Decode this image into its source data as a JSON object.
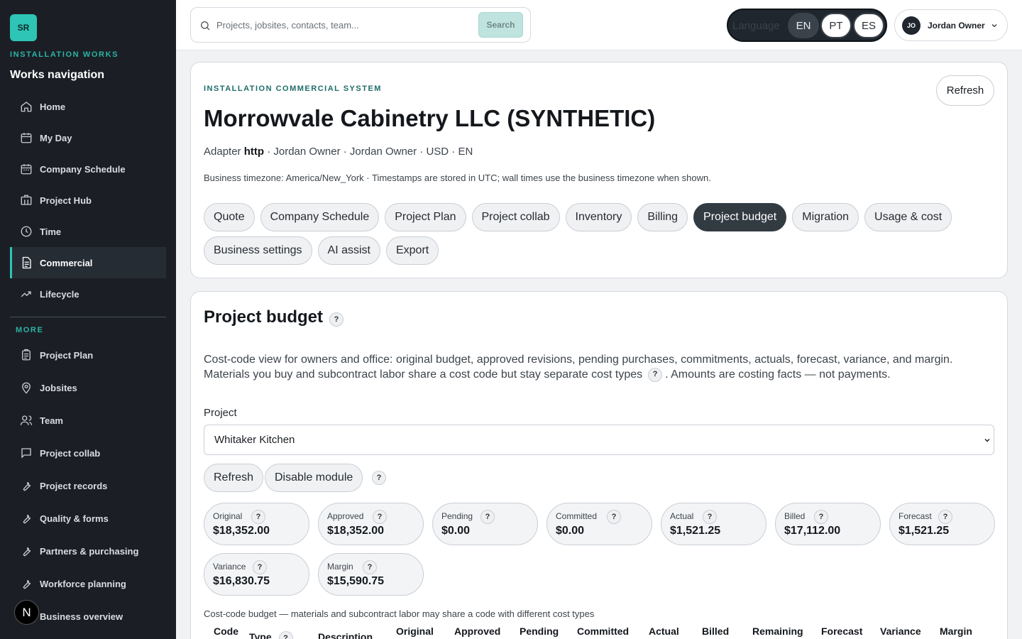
{
  "sidebar": {
    "logo_text": "SR",
    "brand_label": "INSTALLATION WORKS",
    "nav_title": "Works navigation",
    "items": [
      {
        "label": "Home",
        "icon": "home-icon"
      },
      {
        "label": "My Day",
        "icon": "calendar-icon"
      },
      {
        "label": "Company Schedule",
        "icon": "calendar-icon"
      },
      {
        "label": "Project Hub",
        "icon": "building-icon"
      },
      {
        "label": "Time",
        "icon": "clock-icon"
      },
      {
        "label": "Commercial",
        "icon": "document-icon",
        "active": true
      },
      {
        "label": "Lifecycle",
        "icon": "trend-icon"
      }
    ],
    "more_label": "MORE",
    "more_items": [
      {
        "label": "Project Plan",
        "icon": "clipboard-icon"
      },
      {
        "label": "Jobsites",
        "icon": "map-pin-icon"
      },
      {
        "label": "Team",
        "icon": "users-icon"
      },
      {
        "label": "Project collab",
        "icon": "chat-icon"
      },
      {
        "label": "Project records",
        "icon": "wrench-icon"
      },
      {
        "label": "Quality & forms",
        "icon": "wrench-icon"
      },
      {
        "label": "Partners & purchasing",
        "icon": "wrench-icon"
      },
      {
        "label": "Workforce planning",
        "icon": "wrench-icon"
      },
      {
        "label": "Business overview",
        "icon": "wrench-icon"
      }
    ],
    "dev_badge": "N"
  },
  "topbar": {
    "search_placeholder": "Projects, jobsites, contacts, team...",
    "search_button": "Search",
    "language_label": "Language",
    "languages": [
      "EN",
      "PT",
      "ES"
    ],
    "active_language": "EN",
    "user_initials": "JO",
    "user_name": "Jordan Owner"
  },
  "header": {
    "eyebrow": "INSTALLATION COMMERCIAL SYSTEM",
    "company": "Morrowvale Cabinetry LLC (SYNTHETIC)",
    "meta_prefix": "Adapter",
    "adapter": "http",
    "meta_rest": "· Jordan Owner · Jordan Owner · USD · EN",
    "timezone": "Business timezone: America/New_York · Timestamps are stored in UTC; wall times use the business timezone when shown.",
    "refresh": "Refresh",
    "tabs_row1": [
      "Quote",
      "Company Schedule",
      "Project Plan",
      "Project collab",
      "Inventory",
      "Billing",
      "Project budget",
      "Migration",
      "Usage & cost"
    ],
    "tabs_row2": [
      "Business settings",
      "AI assist",
      "Export"
    ],
    "active_tab": "Project budget"
  },
  "budget": {
    "title": "Project budget",
    "help": "?",
    "desc_part1": "Cost-code view for owners and office: original budget, approved revisions, pending purchases, commitments, actuals, forecast, variance, and margin. Materials you buy and subcontract labor share a cost code but stay separate cost types",
    "desc_part2": ". Amounts are costing facts — not payments.",
    "project_label": "Project",
    "project_value": "Whitaker Kitchen",
    "refresh": "Refresh",
    "disable": "Disable module",
    "metrics": [
      {
        "label": "Original",
        "value": "$18,352.00"
      },
      {
        "label": "Approved",
        "value": "$18,352.00"
      },
      {
        "label": "Pending",
        "value": "$0.00"
      },
      {
        "label": "Committed",
        "value": "$0.00"
      },
      {
        "label": "Actual",
        "value": "$1,521.25"
      },
      {
        "label": "Billed",
        "value": "$17,112.00"
      },
      {
        "label": "Forecast",
        "value": "$1,521.25"
      },
      {
        "label": "Variance",
        "value": "$16,830.75"
      },
      {
        "label": "Margin",
        "value": "$15,590.75"
      }
    ],
    "table_caption": "Cost-code budget — materials and subcontract labor may share a code with different cost types",
    "columns": [
      "Code",
      "Type",
      "Description",
      "Original",
      "Approved",
      "Pending",
      "Committed",
      "Actual",
      "Billed",
      "Remaining",
      "Forecast",
      "Variance",
      "Margin"
    ]
  }
}
